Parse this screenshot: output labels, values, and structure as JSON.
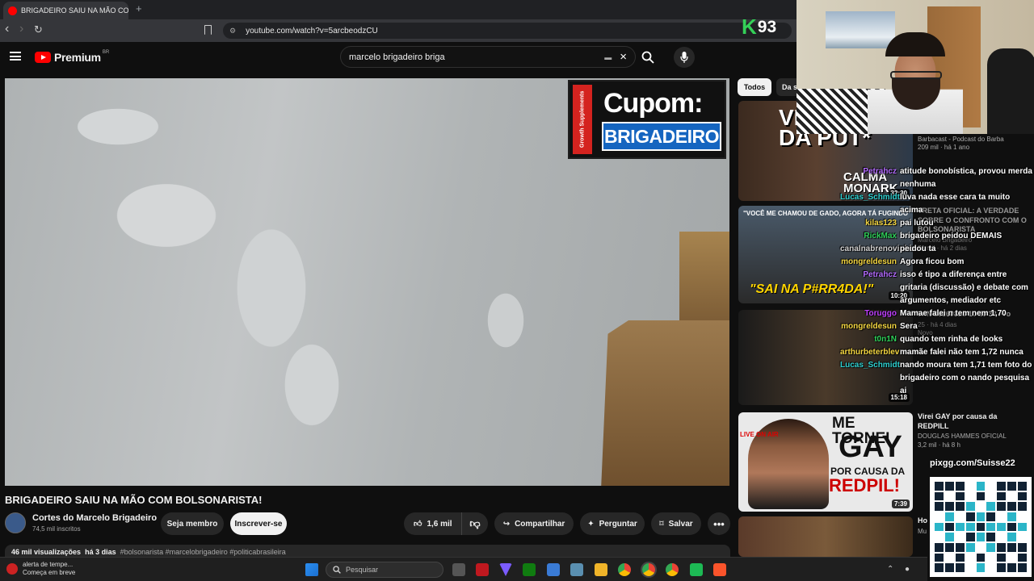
{
  "browser": {
    "tab_title": "BRIGADEIRO SAIU NA MÃO COM",
    "tab_close": "×",
    "new_tab": "+",
    "back": "‹",
    "forward": "›",
    "reload": "↻",
    "url": "youtube.com/watch?v=5arcbeodzCU"
  },
  "overlay_score": {
    "badge": "K",
    "value": "93"
  },
  "youtube": {
    "logo_text": "Premium",
    "logo_region": "BR",
    "search_query": "marcelo brigadeiro briga",
    "search_clear": "×"
  },
  "promo": {
    "brand": "Growth Supplements",
    "line1": "Cupom:",
    "line2": "BRIGADEIRO"
  },
  "video": {
    "title": "BRIGADEIRO SAIU NA MÃO COM BOLSONARISTA!",
    "channel": "Cortes do Marcelo Brigadeiro",
    "subscribers": "74,5 mil inscritos",
    "member_label": "Seja membro",
    "subscribe_label": "Inscrever-se",
    "likes": "1,6 mil",
    "share_label": "Compartilhar",
    "ask_label": "Perguntar",
    "save_label": "Salvar",
    "more_label": "•••",
    "views": "46 mil visualizações",
    "age": "há 3 dias",
    "hashtags": "#bolsonarista #marcelobrigadeiro #politicabrasileira"
  },
  "filters": {
    "all": "Todos",
    "next": "Da s"
  },
  "recommendations": [
    {
      "thumb_big": "VÉ FILHO DA PUT*",
      "thumb_small": "CALMA MONARK",
      "duration": "32:30",
      "title": "",
      "channel": "Barbacast - Podcast do Barba",
      "stats": "209 mil · há 1 ano"
    },
    {
      "thumb_top": "\"VOCÊ ME CHAMOU DE GADO, AGORA TÁ FUGINDO\"",
      "thumb_bottom": "\"SAI NA P#RR4DA!\"",
      "duration": "10:20",
      "title": "TRETA OFICIAL: A VERDADE SOBRE O CONFRONTO COM O BOLSONARISTA",
      "channel": "Marcelo Brigadeiro",
      "stats": "71 mil · há 2 dias"
    },
    {
      "duration": "15:18",
      "title": "WIN 20260826 19 20 32 Pro",
      "channel": "",
      "stats": "25 · há 4 dias",
      "badge": "Novo"
    },
    {
      "thumb_live": "LIVE ON AIR",
      "thumb_line1": "ME TORNEI",
      "thumb_line2": "GAY",
      "thumb_line3": "POR CAUSA DA",
      "thumb_line4": "REDPIL!",
      "duration": "7:39",
      "title": "Virei GAY por causa da REDPILL",
      "channel": "DOUGLAS HAMMES OFICIAL",
      "stats": "3,2 mil · há 8 h"
    },
    {
      "title": "Ho",
      "channel": "Mu"
    }
  ],
  "chat": [
    {
      "user": "Petrahcz",
      "color": "#b46cff",
      "msg": "atitude bonobística, provou merda nenhuma"
    },
    {
      "user": "Lucas_Schmidt",
      "color": "#2fd0d0",
      "msg": "luva nada esse cara ta muito acima"
    },
    {
      "user": "kilas123",
      "color": "#f5d742",
      "msg": "pai lutou"
    },
    {
      "user": "RickMax",
      "color": "#2fd05a",
      "msg": "brigadeiro peidou DEMAIS"
    },
    {
      "user": "canalnabrenovinho",
      "color": "#d0d0d0",
      "msg": "peidou ta"
    },
    {
      "user": "mongreldesun",
      "color": "#f5d742",
      "msg": "Agora ficou bom"
    },
    {
      "user": "Petrahcz",
      "color": "#b46cff",
      "msg": "isso é tipo a diferença entre gritaria (discussão) e debate com argumentos, mediador etc"
    },
    {
      "user": "Toruggo",
      "color": "#c040ff",
      "msg": "Mamae falei n tem nem 1,70"
    },
    {
      "user": "mongreldesun",
      "color": "#f5d742",
      "msg": "Sera"
    },
    {
      "user": "t0n1N",
      "color": "#2fd05a",
      "msg": "quando tem rinha de looks"
    },
    {
      "user": "arthurbeterblev",
      "color": "#f5d742",
      "msg": "mamãe falei não tem 1,72 nunca"
    },
    {
      "user": "Lucas_Schmidt",
      "color": "#2fd0d0",
      "msg": "nando moura tem 1,71 tem foto do brigadeiro com o nando pesquisa ai"
    }
  ],
  "qr_label": "pixgg.com/Suisse22",
  "taskbar": {
    "alert_line1": "alerta de tempe...",
    "alert_line2": "Começa em breve",
    "search_placeholder": "Pesquisar"
  }
}
